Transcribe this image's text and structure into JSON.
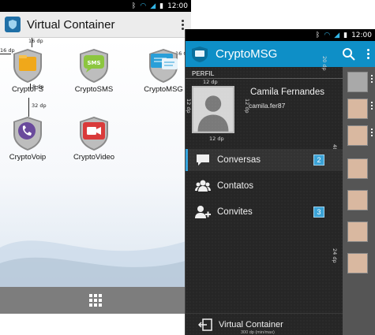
{
  "statusbar": {
    "time": "12:00",
    "icons": [
      "bluetooth-icon",
      "wifi-icon",
      "signal-icon",
      "battery-icon"
    ]
  },
  "launcher": {
    "title": "Virtual Container",
    "apps": [
      {
        "label": "CryptoFS",
        "icon": "folder-shield-icon",
        "color": "#f0a81a"
      },
      {
        "label": "CryptoSMS",
        "icon": "sms-shield-icon",
        "color": "#8cc63f"
      },
      {
        "label": "CryptoMSG",
        "icon": "chat-shield-icon",
        "color": "#2a9fd8"
      },
      {
        "label": "CryptoVoip",
        "icon": "phone-shield-icon",
        "color": "#6a4a9c"
      },
      {
        "label": "CryptoVideo",
        "icon": "video-shield-icon",
        "color": "#d93b3b"
      }
    ],
    "dimensions": {
      "top": "16 dp",
      "left": "16 dp",
      "below_icon": "8 dp",
      "row_gap": "32 dp",
      "right": "16 C"
    },
    "bottom_bar": {
      "icon": "app-grid-icon"
    }
  },
  "messenger": {
    "title": "CryptoMSG",
    "section": "PERFIL",
    "profile": {
      "name": "Camila Fernandes",
      "username": "camila.fer87"
    },
    "menu": [
      {
        "label": "Conversas",
        "icon": "chat-bubble-icon",
        "badge": "2",
        "active": true
      },
      {
        "label": "Contatos",
        "icon": "group-icon",
        "badge": "",
        "active": false
      },
      {
        "label": "Convites",
        "icon": "add-contact-icon",
        "badge": "3",
        "active": false
      }
    ],
    "footer": {
      "label": "Virtual Container",
      "icon": "exit-icon"
    },
    "dimensions": {
      "header_right": "20 dp",
      "avatar_top": "12 dp",
      "avatar_left": "12 dp",
      "avatar_right": "12 dp",
      "avatar_bottom": "12 dp",
      "item_height": "48 dp",
      "item_gap": "24 dp"
    },
    "footnote": "300 dp (min/max)"
  },
  "colors": {
    "accent": "#0e8fc7",
    "badge": "#3aa2d6",
    "drawer_bg": "#262626"
  }
}
